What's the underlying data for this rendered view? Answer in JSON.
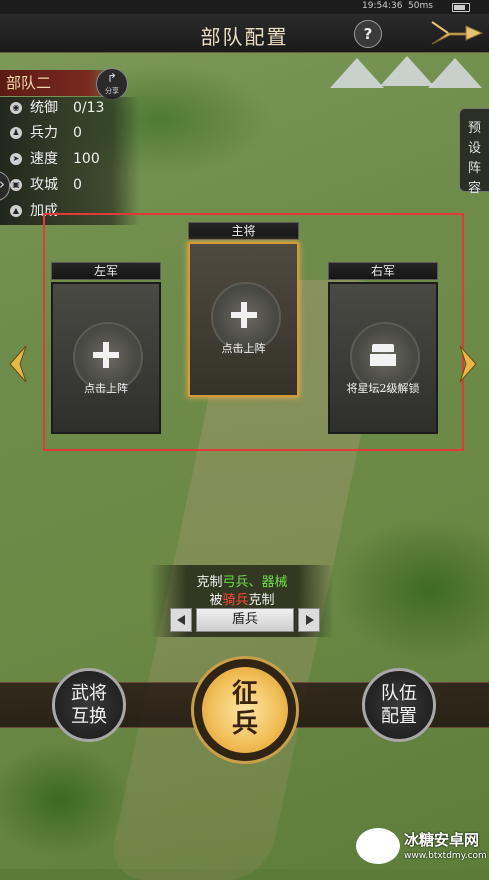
{
  "status_bar": {
    "time": "19:54:36",
    "network": "50ms"
  },
  "header": {
    "title": "部队配置",
    "help_icon": "question-icon",
    "back_icon": "arrow-icon"
  },
  "troop": {
    "name": "部队二",
    "share_label": "分享",
    "stats": [
      {
        "icon": "command-icon",
        "label": "统御",
        "value": "0/13"
      },
      {
        "icon": "soldier-icon",
        "label": "兵力",
        "value": "0"
      },
      {
        "icon": "speed-icon",
        "label": "速度",
        "value": "100"
      },
      {
        "icon": "siege-icon",
        "label": "攻城",
        "value": "0"
      },
      {
        "icon": "bonus-icon",
        "label": "加成",
        "value": ""
      }
    ]
  },
  "preset_label": "预设阵容",
  "slots": {
    "left": {
      "title": "左军",
      "text": "点击上阵",
      "icon": "plus-icon"
    },
    "main": {
      "title": "主将",
      "text": "点击上阵",
      "icon": "plus-icon"
    },
    "right": {
      "title": "右军",
      "text": "将星坛2级解锁",
      "icon": "lock-icon"
    }
  },
  "counter": {
    "prefix": "克制",
    "counters": "弓兵、器械",
    "by_prefix": "被",
    "countered_by": "骑兵",
    "suffix": "克制",
    "troop_type": "盾兵"
  },
  "buttons": {
    "swap": "武将互换",
    "enlist": "征兵",
    "formation": "队伍配置"
  },
  "watermark": {
    "name": "冰糖安卓网",
    "url": "www.btxtdmy.com"
  },
  "colors": {
    "counter_good": "#6fe04a",
    "counter_bad": "#ff4a3a",
    "highlight": "#e23a3a",
    "gold": "#d39a3a"
  }
}
